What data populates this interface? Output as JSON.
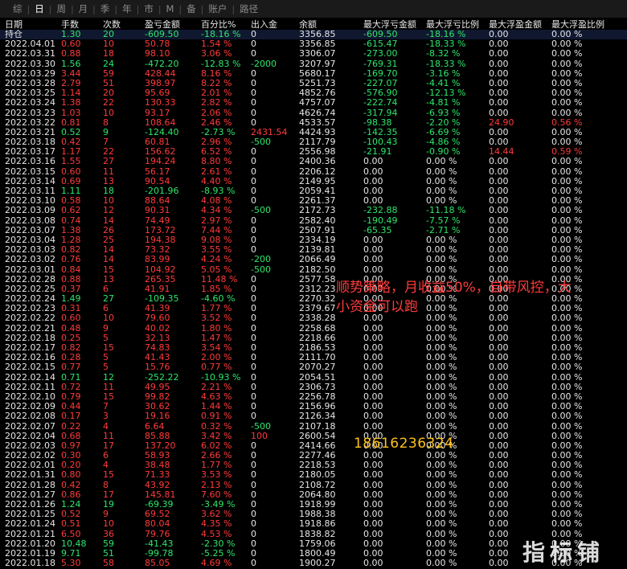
{
  "tabs": [
    {
      "label": "综",
      "active": false
    },
    {
      "label": "日",
      "active": true
    },
    {
      "label": "周",
      "active": false
    },
    {
      "label": "月",
      "active": false
    },
    {
      "label": "季",
      "active": false
    },
    {
      "label": "年",
      "active": false
    },
    {
      "label": "市",
      "active": false
    },
    {
      "label": "M",
      "active": false
    },
    {
      "label": "备",
      "active": false
    },
    {
      "label": "账户",
      "active": false
    },
    {
      "label": "路径",
      "active": false
    }
  ],
  "columns": [
    "日期",
    "手数",
    "次数",
    "盈亏金额",
    "百分比%",
    "出入金",
    "余额",
    "最大浮亏金额",
    "最大浮亏比例",
    "最大浮盈金额",
    "最大浮盈比例"
  ],
  "colors": {
    "positive": "#ff3b3b",
    "negative": "#2ee66b",
    "neutral": "#e6e6e6"
  },
  "rows": [
    [
      "持仓",
      "1.30",
      "20",
      "-609.50",
      "-18.16 %",
      "0",
      "3356.85",
      "-609.50",
      "-18.16 %",
      "0.00",
      "0.00 %"
    ],
    [
      "2022.04.01",
      "0.60",
      "10",
      "50.78",
      "1.54 %",
      "0",
      "3356.85",
      "-615.47",
      "-18.33 %",
      "0.00",
      "0.00 %"
    ],
    [
      "2022.03.31",
      "0.88",
      "18",
      "98.10",
      "3.06 %",
      "0",
      "3306.07",
      "-273.00",
      "-8.32 %",
      "0.00",
      "0.00 %"
    ],
    [
      "2022.03.30",
      "1.56",
      "24",
      "-472.20",
      "-12.83 %",
      "-2000",
      "3207.97",
      "-769.31",
      "-18.33 %",
      "0.00",
      "0.00 %"
    ],
    [
      "2022.03.29",
      "3.44",
      "59",
      "428.44",
      "8.16 %",
      "0",
      "5680.17",
      "-169.70",
      "-3.16 %",
      "0.00",
      "0.00 %"
    ],
    [
      "2022.03.28",
      "2.79",
      "51",
      "398.97",
      "8.22 %",
      "0",
      "5251.73",
      "-227.07",
      "-4.41 %",
      "0.00",
      "0.00 %"
    ],
    [
      "2022.03.25",
      "1.14",
      "20",
      "95.69",
      "2.01 %",
      "0",
      "4852.76",
      "-576.90",
      "-12.13 %",
      "0.00",
      "0.00 %"
    ],
    [
      "2022.03.24",
      "1.38",
      "22",
      "130.33",
      "2.82 %",
      "0",
      "4757.07",
      "-222.74",
      "-4.81 %",
      "0.00",
      "0.00 %"
    ],
    [
      "2022.03.23",
      "1.03",
      "10",
      "93.17",
      "2.06 %",
      "0",
      "4626.74",
      "-317.94",
      "-6.93 %",
      "0.00",
      "0.00 %"
    ],
    [
      "2022.03.22",
      "0.81",
      "8",
      "108.64",
      "2.46 %",
      "0",
      "4533.57",
      "-98.38",
      "-2.20 %",
      "24.90",
      "0.56 %"
    ],
    [
      "2022.03.21",
      "0.52",
      "9",
      "-124.40",
      "-2.73 %",
      "2431.54",
      "4424.93",
      "-142.35",
      "-6.69 %",
      "0.00",
      "0.00 %"
    ],
    [
      "2022.03.18",
      "0.42",
      "7",
      "60.81",
      "2.96 %",
      "-500",
      "2117.79",
      "-100.43",
      "-4.86 %",
      "0.00",
      "0.00 %"
    ],
    [
      "2022.03.17",
      "1.17",
      "22",
      "156.62",
      "6.52 %",
      "0",
      "2556.98",
      "-21.91",
      "-0.90 %",
      "14.44",
      "0.59 %"
    ],
    [
      "2022.03.16",
      "1.55",
      "27",
      "194.24",
      "8.80 %",
      "0",
      "2400.36",
      "0.00",
      "0.00 %",
      "0.00",
      "0.00 %"
    ],
    [
      "2022.03.15",
      "0.60",
      "11",
      "56.17",
      "2.61 %",
      "0",
      "2206.12",
      "0.00",
      "0.00 %",
      "0.00",
      "0.00 %"
    ],
    [
      "2022.03.14",
      "0.69",
      "13",
      "90.54",
      "4.40 %",
      "0",
      "2149.95",
      "0.00",
      "0.00 %",
      "0.00",
      "0.00 %"
    ],
    [
      "2022.03.11",
      "1.11",
      "18",
      "-201.96",
      "-8.93 %",
      "0",
      "2059.41",
      "0.00",
      "0.00 %",
      "0.00",
      "0.00 %"
    ],
    [
      "2022.03.10",
      "0.58",
      "10",
      "88.64",
      "4.08 %",
      "0",
      "2261.37",
      "0.00",
      "0.00 %",
      "0.00",
      "0.00 %"
    ],
    [
      "2022.03.09",
      "0.62",
      "12",
      "90.31",
      "4.34 %",
      "-500",
      "2172.73",
      "-232.88",
      "-11.18 %",
      "0.00",
      "0.00 %"
    ],
    [
      "2022.03.08",
      "0.74",
      "14",
      "74.49",
      "2.97 %",
      "0",
      "2582.40",
      "-190.49",
      "-7.57 %",
      "0.00",
      "0.00 %"
    ],
    [
      "2022.03.07",
      "1.38",
      "26",
      "173.72",
      "7.44 %",
      "0",
      "2507.91",
      "-65.35",
      "-2.71 %",
      "0.00",
      "0.00 %"
    ],
    [
      "2022.03.04",
      "1.28",
      "25",
      "194.38",
      "9.08 %",
      "0",
      "2334.19",
      "0.00",
      "0.00 %",
      "0.00",
      "0.00 %"
    ],
    [
      "2022.03.03",
      "0.82",
      "14",
      "73.32",
      "3.55 %",
      "0",
      "2139.81",
      "0.00",
      "0.00 %",
      "0.00",
      "0.00 %"
    ],
    [
      "2022.03.02",
      "0.76",
      "14",
      "83.99",
      "4.24 %",
      "-200",
      "2066.49",
      "0.00",
      "0.00 %",
      "0.00",
      "0.00 %"
    ],
    [
      "2022.03.01",
      "0.84",
      "15",
      "104.92",
      "5.05 %",
      "-500",
      "2182.50",
      "0.00",
      "0.00 %",
      "0.00",
      "0.00 %"
    ],
    [
      "2022.02.28",
      "0.88",
      "13",
      "265.35",
      "11.48 %",
      "0",
      "2577.58",
      "0.00",
      "0.00 %",
      "0.00",
      "0.00 %"
    ],
    [
      "2022.02.25",
      "0.37",
      "6",
      "41.91",
      "1.85 %",
      "0",
      "2312.23",
      "0.00",
      "0.00 %",
      "0.00",
      "0.00 %"
    ],
    [
      "2022.02.24",
      "1.49",
      "27",
      "-109.35",
      "-4.60 %",
      "0",
      "2270.32",
      "0.00",
      "0.00 %",
      "0.00",
      "0.00 %"
    ],
    [
      "2022.02.23",
      "0.31",
      "6",
      "41.39",
      "1.77 %",
      "0",
      "2379.67",
      "0.00",
      "0.00 %",
      "0.00",
      "0.00 %"
    ],
    [
      "2022.02.22",
      "0.60",
      "10",
      "79.60",
      "3.52 %",
      "0",
      "2338.28",
      "0.00",
      "0.00 %",
      "0.00",
      "0.00 %"
    ],
    [
      "2022.02.21",
      "0.48",
      "9",
      "40.02",
      "1.80 %",
      "0",
      "2258.68",
      "0.00",
      "0.00 %",
      "0.00",
      "0.00 %"
    ],
    [
      "2022.02.18",
      "0.25",
      "5",
      "32.13",
      "1.47 %",
      "0",
      "2218.66",
      "0.00",
      "0.00 %",
      "0.00",
      "0.00 %"
    ],
    [
      "2022.02.17",
      "0.82",
      "15",
      "74.83",
      "3.54 %",
      "0",
      "2186.53",
      "0.00",
      "0.00 %",
      "0.00",
      "0.00 %"
    ],
    [
      "2022.02.16",
      "0.28",
      "5",
      "41.43",
      "2.00 %",
      "0",
      "2111.70",
      "0.00",
      "0.00 %",
      "0.00",
      "0.00 %"
    ],
    [
      "2022.02.15",
      "0.77",
      "5",
      "15.76",
      "0.77 %",
      "0",
      "2070.27",
      "0.00",
      "0.00 %",
      "0.00",
      "0.00 %"
    ],
    [
      "2022.02.14",
      "0.71",
      "12",
      "-252.22",
      "-10.93 %",
      "0",
      "2054.51",
      "0.00",
      "0.00 %",
      "0.00",
      "0.00 %"
    ],
    [
      "2022.02.11",
      "0.72",
      "11",
      "49.95",
      "2.21 %",
      "0",
      "2306.73",
      "0.00",
      "0.00 %",
      "0.00",
      "0.00 %"
    ],
    [
      "2022.02.10",
      "0.79",
      "15",
      "99.82",
      "4.63 %",
      "0",
      "2256.78",
      "0.00",
      "0.00 %",
      "0.00",
      "0.00 %"
    ],
    [
      "2022.02.09",
      "0.44",
      "7",
      "30.62",
      "1.44 %",
      "0",
      "2156.96",
      "0.00",
      "0.00 %",
      "0.00",
      "0.00 %"
    ],
    [
      "2022.02.08",
      "0.17",
      "3",
      "19.16",
      "0.91 %",
      "0",
      "2126.34",
      "0.00",
      "0.00 %",
      "0.00",
      "0.00 %"
    ],
    [
      "2022.02.07",
      "0.22",
      "4",
      "6.64",
      "0.32 %",
      "-500",
      "2107.18",
      "0.00",
      "0.00 %",
      "0.00",
      "0.00 %"
    ],
    [
      "2022.02.04",
      "0.68",
      "11",
      "85.88",
      "3.42 %",
      "100",
      "2600.54",
      "0.00",
      "0.00 %",
      "0.00",
      "0.00 %"
    ],
    [
      "2022.02.03",
      "0.97",
      "17",
      "137.20",
      "6.02 %",
      "0",
      "2414.66",
      "0.00",
      "0.00 %",
      "0.00",
      "0.00 %"
    ],
    [
      "2022.02.02",
      "0.30",
      "6",
      "58.93",
      "2.66 %",
      "0",
      "2277.46",
      "0.00",
      "0.00 %",
      "0.00",
      "0.00 %"
    ],
    [
      "2022.02.01",
      "0.20",
      "4",
      "38.48",
      "1.77 %",
      "0",
      "2218.53",
      "0.00",
      "0.00 %",
      "0.00",
      "0.00 %"
    ],
    [
      "2022.01.31",
      "0.80",
      "15",
      "71.33",
      "3.53 %",
      "0",
      "2180.05",
      "0.00",
      "0.00 %",
      "0.00",
      "0.00 %"
    ],
    [
      "2022.01.28",
      "0.42",
      "8",
      "43.92",
      "2.13 %",
      "0",
      "2108.72",
      "0.00",
      "0.00 %",
      "0.00",
      "0.00 %"
    ],
    [
      "2022.01.27",
      "0.86",
      "17",
      "145.81",
      "7.60 %",
      "0",
      "2064.80",
      "0.00",
      "0.00 %",
      "0.00",
      "0.00 %"
    ],
    [
      "2022.01.26",
      "1.24",
      "19",
      "-69.39",
      "-3.49 %",
      "0",
      "1918.99",
      "0.00",
      "0.00 %",
      "0.00",
      "0.00 %"
    ],
    [
      "2022.01.25",
      "0.52",
      "9",
      "69.52",
      "3.62 %",
      "0",
      "1988.38",
      "0.00",
      "0.00 %",
      "0.00",
      "0.00 %"
    ],
    [
      "2022.01.24",
      "0.51",
      "10",
      "80.04",
      "4.35 %",
      "0",
      "1918.86",
      "0.00",
      "0.00 %",
      "0.00",
      "0.00 %"
    ],
    [
      "2022.01.21",
      "6.50",
      "36",
      "79.76",
      "4.53 %",
      "0",
      "1838.82",
      "0.00",
      "0.00 %",
      "0.00",
      "0.00 %"
    ],
    [
      "2022.01.20",
      "10.48",
      "59",
      "-41.43",
      "-2.30 %",
      "0",
      "1759.06",
      "0.00",
      "0.00 %",
      "0.00",
      "0.00 %"
    ],
    [
      "2022.01.19",
      "9.71",
      "51",
      "-99.78",
      "-5.25 %",
      "0",
      "1800.49",
      "0.00",
      "0.00 %",
      "0.00",
      "0.00 %"
    ],
    [
      "2022.01.18",
      "5.30",
      "58",
      "85.05",
      "4.69 %",
      "0",
      "1900.27",
      "0.00",
      "0.00 %",
      "0.00",
      "0.00 %"
    ]
  ],
  "overlay": {
    "note_line1": "顺势策略，月收益50%，自带风控，大",
    "note_line2": "小资金可以跑",
    "phone": "18616236324",
    "logo": "指标铺"
  }
}
